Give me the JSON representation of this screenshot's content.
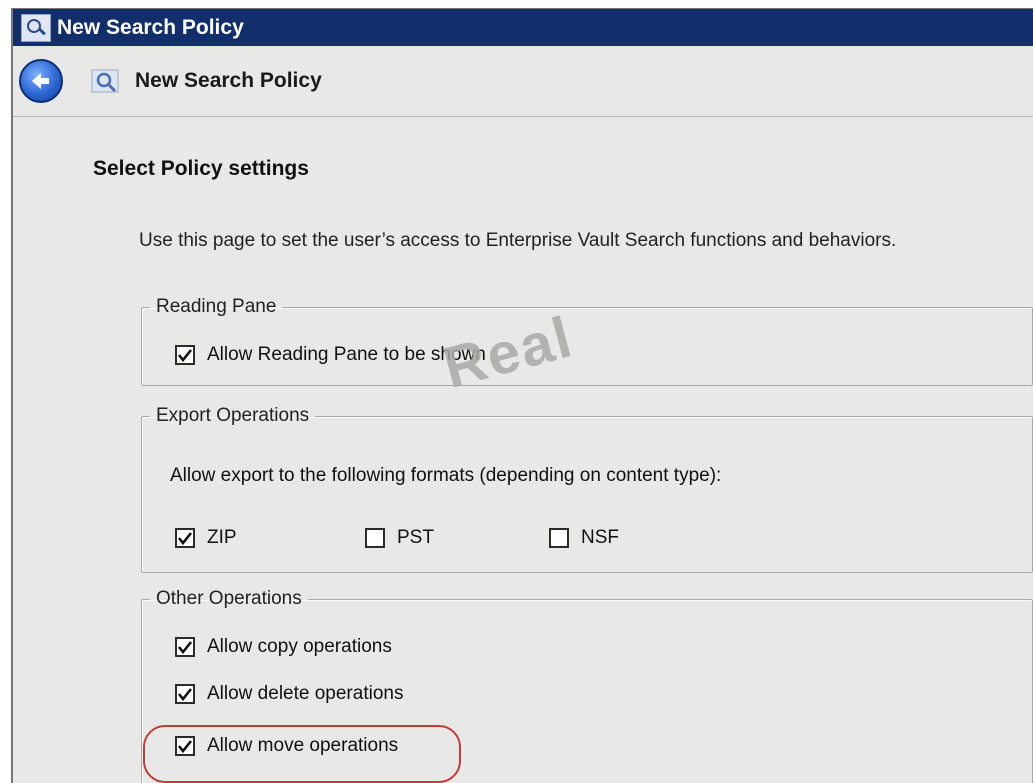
{
  "window": {
    "title": "New Search Policy",
    "nav_title": "New Search Policy"
  },
  "page": {
    "heading": "Select Policy settings",
    "intro": "Use this page to set the user’s access to Enterprise Vault Search functions and behaviors."
  },
  "reading_pane": {
    "legend": "Reading Pane",
    "allow_reading_pane": {
      "label": "Allow Reading Pane to be shown",
      "checked": true
    }
  },
  "export_operations": {
    "legend": "Export Operations",
    "description": "Allow export to the following formats (depending on content type):",
    "formats": [
      {
        "label": "ZIP",
        "checked": true
      },
      {
        "label": "PST",
        "checked": false
      },
      {
        "label": "NSF",
        "checked": false
      }
    ]
  },
  "other_operations": {
    "legend": "Other Operations",
    "items": [
      {
        "label": "Allow copy operations",
        "checked": true
      },
      {
        "label": "Allow delete operations",
        "checked": true
      },
      {
        "label": "Allow move operations",
        "checked": true
      }
    ]
  },
  "watermark": "Real",
  "colors": {
    "titlebar": "#122f6b",
    "window_bg": "#e8e8e6",
    "highlight": "#c33a3a"
  },
  "icons": {
    "app": "search-policy-icon",
    "back": "back-arrow-icon",
    "nav": "search-policy-icon"
  }
}
